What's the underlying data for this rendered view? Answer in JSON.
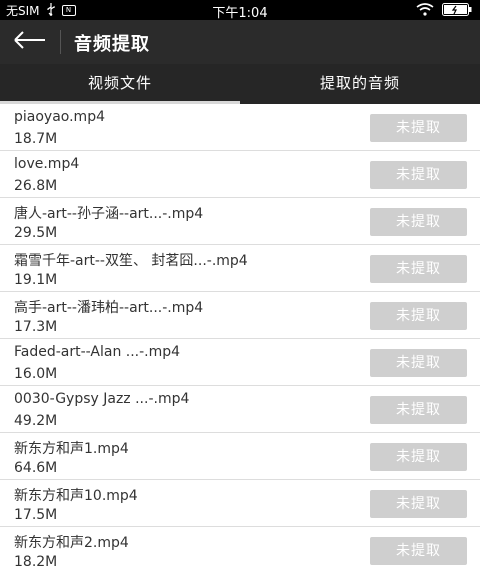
{
  "status_bar": {
    "carrier": "无SIM",
    "time": "下午1:04",
    "sim_icon_label": "N"
  },
  "app_bar": {
    "title": "音频提取"
  },
  "tabs": [
    {
      "label": "视频文件",
      "active": true
    },
    {
      "label": "提取的音频",
      "active": false
    }
  ],
  "files": [
    {
      "name": "piaoyao.mp4",
      "size": "18.7M",
      "action": "未提取"
    },
    {
      "name": "love.mp4",
      "size": "26.8M",
      "action": "未提取"
    },
    {
      "name": "唐人-art--孙子涵--art...-.mp4",
      "size": "29.5M",
      "action": "未提取"
    },
    {
      "name": "霜雪千年-art--双笙、 封茗囧...-.mp4",
      "size": "19.1M",
      "action": "未提取"
    },
    {
      "name": "高手-art--潘玮柏--art...-.mp4",
      "size": "17.3M",
      "action": "未提取"
    },
    {
      "name": "Faded-art--Alan ...-.mp4",
      "size": "16.0M",
      "action": "未提取"
    },
    {
      "name": "0030-Gypsy Jazz ...-.mp4",
      "size": "49.2M",
      "action": "未提取"
    },
    {
      "name": "新东方和声1.mp4",
      "size": "64.6M",
      "action": "未提取"
    },
    {
      "name": "新东方和声10.mp4",
      "size": "17.5M",
      "action": "未提取"
    },
    {
      "name": "新东方和声2.mp4",
      "size": "18.2M",
      "action": "未提取"
    }
  ]
}
